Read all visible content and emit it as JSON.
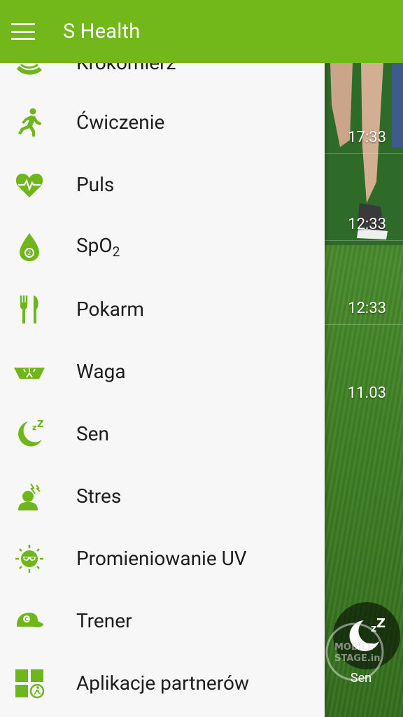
{
  "app": {
    "title": "S Health"
  },
  "drawer": {
    "items": [
      {
        "label": "Krokomierz",
        "icon": "pedometer-icon"
      },
      {
        "label": "Ćwiczenie",
        "icon": "running-icon"
      },
      {
        "label": "Puls",
        "icon": "heart-rate-icon"
      },
      {
        "label": "SpO",
        "label_sub": "2",
        "icon": "spo2-drop-icon"
      },
      {
        "label": "Pokarm",
        "icon": "fork-knife-icon"
      },
      {
        "label": "Waga",
        "icon": "scale-icon"
      },
      {
        "label": "Sen",
        "icon": "sleep-moon-icon"
      },
      {
        "label": "Stres",
        "icon": "stress-head-icon"
      },
      {
        "label": "Promieniowanie UV",
        "icon": "uv-sun-icon"
      },
      {
        "label": "Trener",
        "icon": "coach-cap-icon"
      },
      {
        "label": "Aplikacje partnerów",
        "icon": "partner-apps-icon"
      }
    ]
  },
  "background": {
    "times": [
      "17:33",
      "12:33",
      "12:33",
      "11.03"
    ],
    "sleep_button_label": "Sen",
    "watermark": "MOBILE STAGE.in"
  },
  "colors": {
    "accent": "#72b81b",
    "drawer_bg": "#f7f7f7",
    "icon": "#6fb51c"
  }
}
